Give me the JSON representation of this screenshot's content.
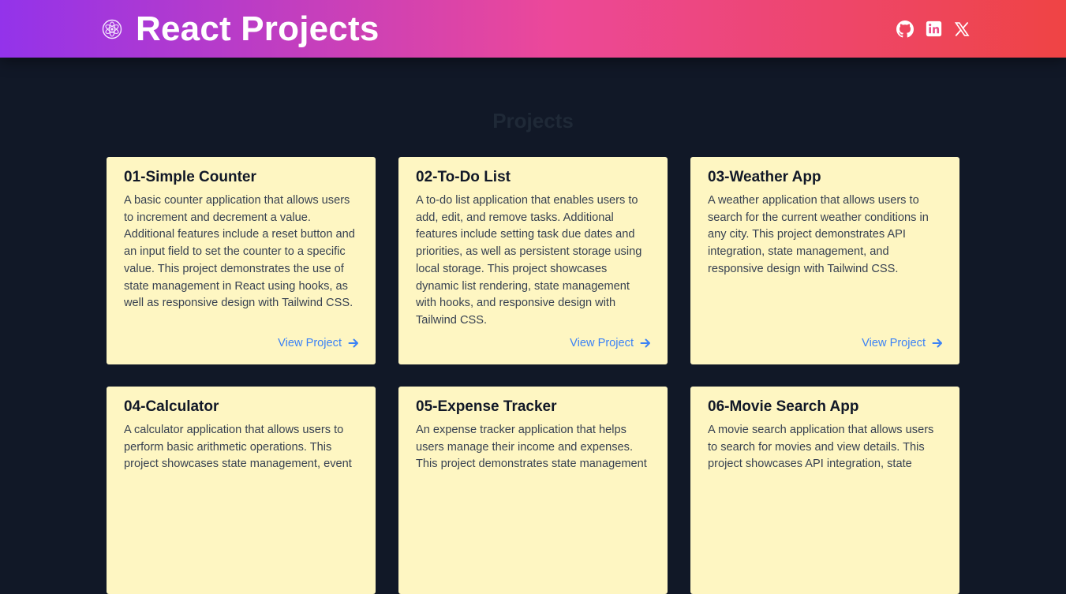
{
  "header": {
    "title": "React Projects",
    "logo_icon": "react-logo-icon",
    "social": [
      {
        "name": "github-icon",
        "label": "GitHub"
      },
      {
        "name": "linkedin-icon",
        "label": "LinkedIn"
      },
      {
        "name": "x-twitter-icon",
        "label": "X"
      }
    ],
    "gradient_colors": [
      "#9333ea",
      "#ec4899",
      "#ef4444"
    ]
  },
  "main": {
    "section_title": "Projects",
    "link_label": "View Project",
    "link_icon": "arrow-right-icon",
    "projects": [
      {
        "title": "01-Simple Counter",
        "description": "A basic counter application that allows users to increment and decrement a value. Additional features include a reset button and an input field to set the counter to a specific value. This project demonstrates the use of state management in React using hooks, as well as responsive design with Tailwind CSS."
      },
      {
        "title": "02-To-Do List",
        "description": "A to-do list application that enables users to add, edit, and remove tasks. Additional features include setting task due dates and priorities, as well as persistent storage using local storage. This project showcases dynamic list rendering, state management with hooks, and responsive design with Tailwind CSS."
      },
      {
        "title": "03-Weather App",
        "description": "A weather application that allows users to search for the current weather conditions in any city. This project demonstrates API integration, state management, and responsive design with Tailwind CSS."
      },
      {
        "title": "04-Calculator",
        "description": "A calculator application that allows users to perform basic arithmetic operations. This project showcases state management, event"
      },
      {
        "title": "05-Expense Tracker",
        "description": "An expense tracker application that helps users manage their income and expenses. This project demonstrates state management"
      },
      {
        "title": "06-Movie Search App",
        "description": "A movie search application that allows users to search for movies and view details. This project showcases API integration, state"
      }
    ]
  },
  "colors": {
    "background": "#111827",
    "card": "#fef6c2",
    "card_title": "#111827",
    "card_text": "#374151",
    "link": "#3b82f6",
    "section_title": "#1f2937"
  }
}
